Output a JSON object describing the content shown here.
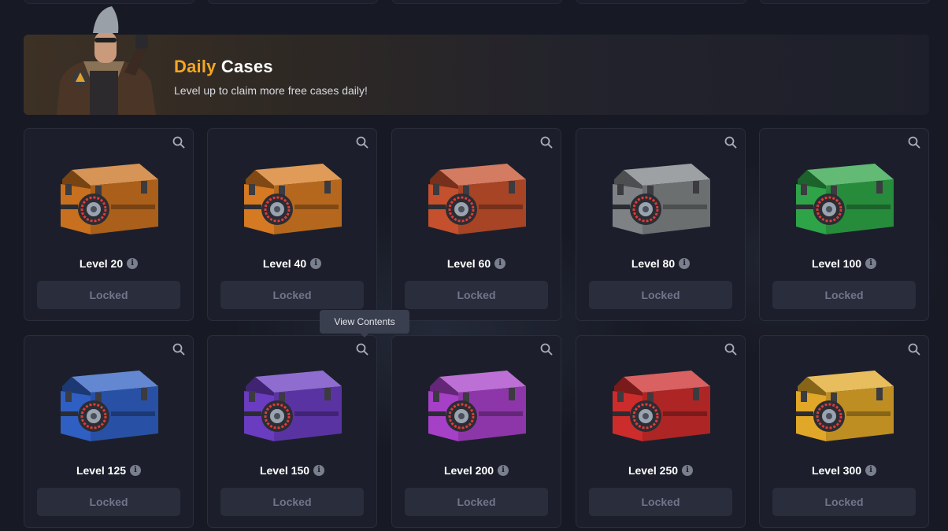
{
  "banner": {
    "title_accent": "Daily",
    "title_rest": "Cases",
    "subtitle": "Level up to claim more free cases daily!",
    "accent_color": "#f6a623"
  },
  "tooltip": {
    "text": "View Contents"
  },
  "cases": [
    {
      "level_label": "Level 20",
      "button": "Locked",
      "color": "#c8701f",
      "icon": "search-icon"
    },
    {
      "level_label": "Level 40",
      "button": "Locked",
      "color": "#d57a22",
      "icon": "search-icon"
    },
    {
      "level_label": "Level 60",
      "button": "Locked",
      "color": "#c4502d",
      "icon": "search-icon"
    },
    {
      "level_label": "Level 80",
      "button": "Locked",
      "color": "#7e8284",
      "icon": "search-icon"
    },
    {
      "level_label": "Level 100",
      "button": "Locked",
      "color": "#2ea347",
      "icon": "search-icon"
    },
    {
      "level_label": "Level 125",
      "button": "Locked",
      "color": "#2f5fc2",
      "icon": "search-icon"
    },
    {
      "level_label": "Level 150",
      "button": "Locked",
      "color": "#6a3cc0",
      "icon": "search-icon"
    },
    {
      "level_label": "Level 200",
      "button": "Locked",
      "color": "#a640c7",
      "icon": "search-icon"
    },
    {
      "level_label": "Level 250",
      "button": "Locked",
      "color": "#cc2c2c",
      "icon": "search-icon"
    },
    {
      "level_label": "Level 300",
      "button": "Locked",
      "color": "#e0a728",
      "icon": "search-icon"
    }
  ]
}
